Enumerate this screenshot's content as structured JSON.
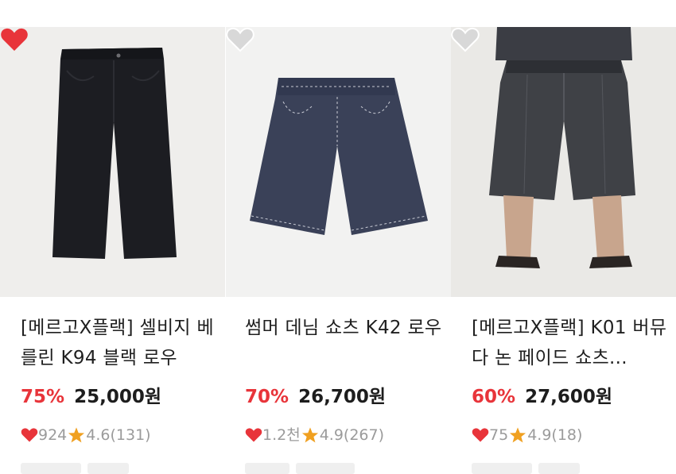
{
  "products": [
    {
      "image_name": "black-wide-pants-photo",
      "liked": true,
      "title": "[메르고X플랙] 셀비지 베를린 K94 블랙 로우",
      "discount": "75%",
      "price": "25,000원",
      "likes": "924",
      "rating": "4.6",
      "reviews": "(131)"
    },
    {
      "image_name": "denim-shorts-photo",
      "liked": false,
      "title": "썸머 데님 쇼츠 K42 로우",
      "discount": "70%",
      "price": "26,700원",
      "likes": "1.2천",
      "rating": "4.9",
      "reviews": "(267)"
    },
    {
      "image_name": "model-bermuda-shorts-photo",
      "liked": false,
      "title": "[메르고X플랙] K01 버뮤다 논 페이드 쇼츠...",
      "discount": "60%",
      "price": "27,600원",
      "likes": "75",
      "rating": "4.9",
      "reviews": "(18)"
    }
  ],
  "colors": {
    "accent_red": "#e8343a",
    "star_orange": "#f0a020",
    "muted_gray": "#9b9b9b",
    "heart_inactive": "#d8d8d8"
  }
}
